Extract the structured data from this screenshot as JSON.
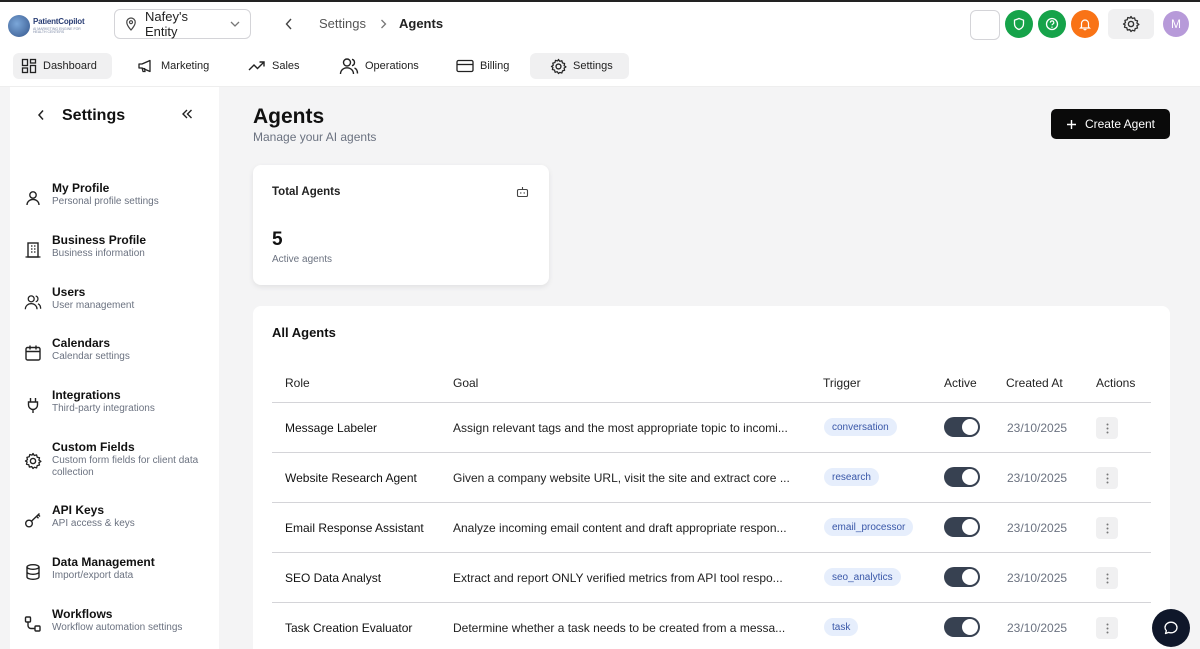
{
  "brand": {
    "line1": "PatientCopilot",
    "line2": "AI MARKETING ENGINE FOR HEALTH CENTERS"
  },
  "header": {
    "entity": "Nafey's Entity",
    "breadcrumb_parent": "Settings",
    "breadcrumb_current": "Agents",
    "avatar_initial": "M",
    "icon_colors": {
      "shield": "#16a34a",
      "help": "#16a34a",
      "bell": "#f97316",
      "avatar": "#b79ad9"
    }
  },
  "nav": {
    "tabs": [
      {
        "label": "Dashboard",
        "icon": "dashboard-icon"
      },
      {
        "label": "Marketing",
        "icon": "megaphone-icon"
      },
      {
        "label": "Sales",
        "icon": "trending-icon"
      },
      {
        "label": "Operations",
        "icon": "users-icon"
      },
      {
        "label": "Billing",
        "icon": "card-icon"
      },
      {
        "label": "Settings",
        "icon": "gear-icon",
        "active": true
      }
    ]
  },
  "sidebar": {
    "title": "Settings",
    "items": [
      {
        "label": "My Profile",
        "sub": "Personal profile settings",
        "icon": "user-icon"
      },
      {
        "label": "Business Profile",
        "sub": "Business information",
        "icon": "building-icon"
      },
      {
        "label": "Users",
        "sub": "User management",
        "icon": "users-icon"
      },
      {
        "label": "Calendars",
        "sub": "Calendar settings",
        "icon": "calendar-icon"
      },
      {
        "label": "Integrations",
        "sub": "Third-party integrations",
        "icon": "plug-icon"
      },
      {
        "label": "Custom Fields",
        "sub": "Custom form fields for client data collection",
        "icon": "gear-icon"
      },
      {
        "label": "API Keys",
        "sub": "API access & keys",
        "icon": "key-icon"
      },
      {
        "label": "Data Management",
        "sub": "Import/export data",
        "icon": "database-icon"
      },
      {
        "label": "Workflows",
        "sub": "Workflow automation settings",
        "icon": "workflow-icon"
      }
    ]
  },
  "main": {
    "title": "Agents",
    "subtitle": "Manage your AI agents",
    "create_label": "Create Agent",
    "card": {
      "title": "Total Agents",
      "value": "5",
      "sub": "Active agents"
    },
    "table": {
      "title": "All Agents",
      "headers": [
        "Role",
        "Goal",
        "Trigger",
        "Active",
        "Created At",
        "Actions"
      ],
      "rows": [
        {
          "role": "Message Labeler",
          "goal": "Assign relevant tags and the most appropriate topic to incomi...",
          "trigger": "conversation",
          "active": true,
          "created": "23/10/2025"
        },
        {
          "role": "Website Research Agent",
          "goal": "Given a company website URL, visit the site and extract core ...",
          "trigger": "research",
          "active": true,
          "created": "23/10/2025"
        },
        {
          "role": "Email Response Assistant",
          "goal": "Analyze incoming email content and draft appropriate respon...",
          "trigger": "email_processor",
          "active": true,
          "created": "23/10/2025"
        },
        {
          "role": "SEO Data Analyst",
          "goal": "Extract and report ONLY verified metrics from API tool respo...",
          "trigger": "seo_analytics",
          "active": true,
          "created": "23/10/2025"
        },
        {
          "role": "Task Creation Evaluator",
          "goal": "Determine whether a task needs to be created from a messa...",
          "trigger": "task",
          "active": true,
          "created": "23/10/2025"
        }
      ]
    }
  }
}
